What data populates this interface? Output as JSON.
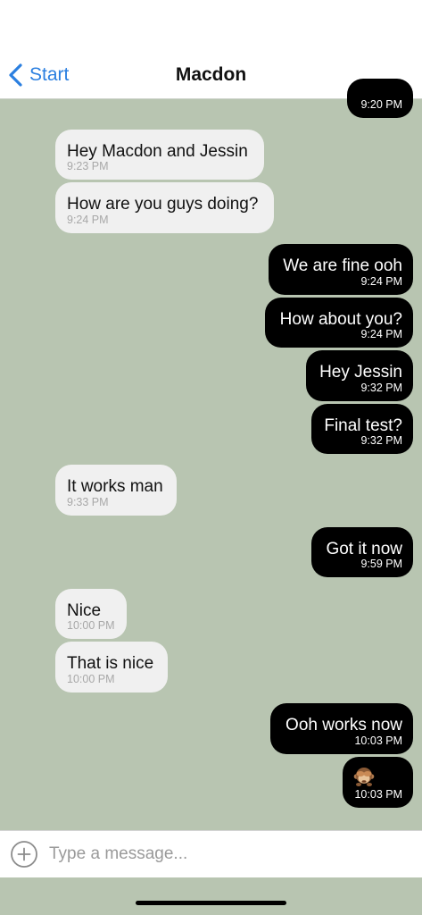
{
  "header": {
    "back_label": "Start",
    "title": "Macdon",
    "back_icon": "chevron-left-icon",
    "accent_color": "#2b7fe0"
  },
  "messages": [
    {
      "direction": "outgoing",
      "text": "",
      "time": "9:20 PM"
    },
    {
      "direction": "incoming",
      "text": "Hey Macdon and Jessin",
      "time": "9:23 PM"
    },
    {
      "direction": "incoming",
      "text": "How are you guys doing?",
      "time": "9:24 PM"
    },
    {
      "direction": "outgoing",
      "text": "We are fine ooh",
      "time": "9:24 PM"
    },
    {
      "direction": "outgoing",
      "text": "How about you?",
      "time": "9:24 PM"
    },
    {
      "direction": "outgoing",
      "text": "Hey Jessin",
      "time": "9:32 PM"
    },
    {
      "direction": "outgoing",
      "text": "Final test?",
      "time": "9:32 PM"
    },
    {
      "direction": "incoming",
      "text": "It works man",
      "time": "9:33 PM"
    },
    {
      "direction": "outgoing",
      "text": "Got it now",
      "time": "9:59 PM"
    },
    {
      "direction": "incoming",
      "text": "Nice",
      "time": "10:00 PM"
    },
    {
      "direction": "incoming",
      "text": "That is nice",
      "time": "10:00 PM"
    },
    {
      "direction": "outgoing",
      "text": "Ooh works now",
      "time": "10:03 PM"
    },
    {
      "direction": "outgoing",
      "text": "",
      "emoji": "see-no-evil-monkey-emoji",
      "time": "10:03 PM"
    }
  ],
  "composer": {
    "placeholder": "Type a message...",
    "value": "",
    "attach_icon": "add-circle-icon"
  },
  "colors": {
    "chat_background": "#b8c5b1",
    "incoming_bubble": "#f0f0f0",
    "outgoing_bubble": "#000000"
  }
}
